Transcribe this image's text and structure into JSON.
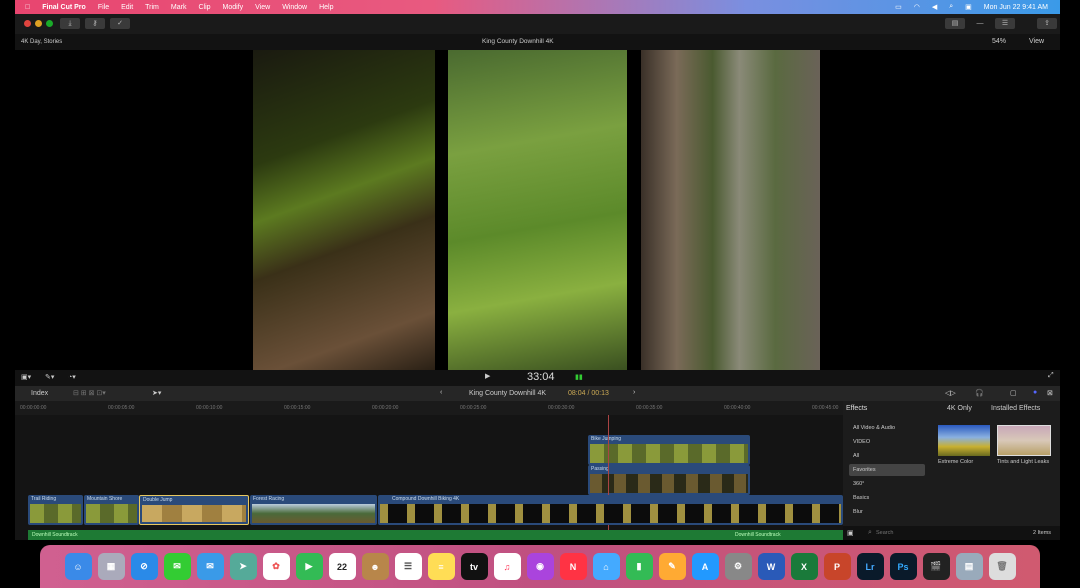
{
  "menubar": {
    "app": "Final Cut Pro",
    "items": [
      "File",
      "Edit",
      "Trim",
      "Mark",
      "Clip",
      "Modify",
      "View",
      "Window",
      "Help"
    ],
    "clock": "Mon Jun 22  9:41 AM"
  },
  "viewer": {
    "library": "4K Day, Stories",
    "title": "King County Downhill 4K",
    "zoom": "54%",
    "view": "View",
    "timecode": "33:04"
  },
  "timeline": {
    "index": "Index",
    "project": "King County Downhill 4K",
    "duration": "08:04 / 00:13",
    "ruler": [
      "00:00:00:00",
      "00:00:05:00",
      "00:00:10:00",
      "00:00:15:00",
      "00:00:20:00",
      "00:00:25:00",
      "00:00:30:00",
      "00:00:35:00",
      "00:00:40:00",
      "00:00:45:00"
    ],
    "clips": {
      "connected": [
        "Bike Jumping",
        "Passing"
      ],
      "main": [
        "Trail Riding",
        "Mountain Shore",
        "Double Jump",
        "Forest Racing",
        "Compound Downhill Biking 4K"
      ],
      "audio": [
        "Downhill Soundtrack",
        "Downhill Soundtrack"
      ]
    }
  },
  "effects": {
    "title": "Effects",
    "filter": "4K Only",
    "source": "Installed Effects",
    "categories": [
      "All Video & Audio",
      "VIDEO",
      "All",
      "Favorites",
      "360°",
      "Basics",
      "Blur"
    ],
    "selected": "Favorites",
    "items": [
      "Extreme Color",
      "Tints and Light Leaks"
    ],
    "search_placeholder": "Search",
    "count": "2 Items"
  },
  "dock": {
    "calendar_day": "22",
    "apps": [
      "Finder",
      "Launchpad",
      "Safari",
      "Messages",
      "Mail",
      "Maps",
      "Photos",
      "FaceTime",
      "Calendar",
      "Contacts",
      "Reminders",
      "Notes",
      "TV",
      "Music",
      "Podcasts",
      "News",
      "Keynote",
      "Numbers",
      "Pages",
      "App Store",
      "System Preferences",
      "Word",
      "Excel",
      "PowerPoint",
      "Lightroom",
      "Photoshop",
      "Final Cut Pro",
      "Preview",
      "Trash"
    ]
  }
}
